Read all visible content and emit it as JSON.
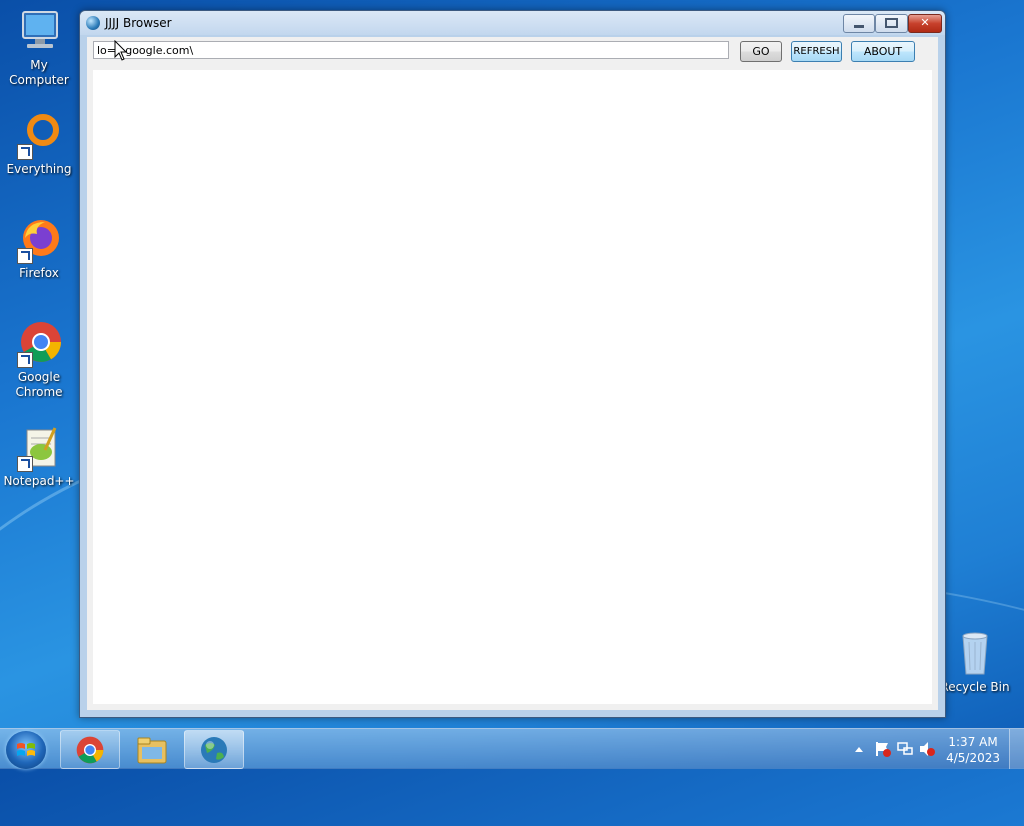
{
  "desktop": {
    "icons": [
      {
        "label": "My Computer"
      },
      {
        "label": "Everything"
      },
      {
        "label": "Firefox"
      },
      {
        "label": "Google Chrome"
      },
      {
        "label": "Notepad++"
      },
      {
        "label": "Recycle Bin"
      }
    ]
  },
  "window": {
    "title": "JJJJ Browser",
    "url_value": "lo==google.com\\",
    "go_label": "GO",
    "refresh_label": "REFRESH",
    "about_label": "ABOUT",
    "close_glyph": "✕"
  },
  "taskbar": {
    "items": [
      "chrome-icon",
      "file-explorer-icon",
      "browser-globe-icon"
    ],
    "time": "1:37 AM",
    "date": "4/5/2023",
    "tray_icons": [
      "show-hidden-icons",
      "action-center-flag-icon",
      "network-icon",
      "volume-muted-icon"
    ]
  },
  "colors": {
    "accent": "#1f7fd4",
    "close_red": "#c7412c"
  }
}
